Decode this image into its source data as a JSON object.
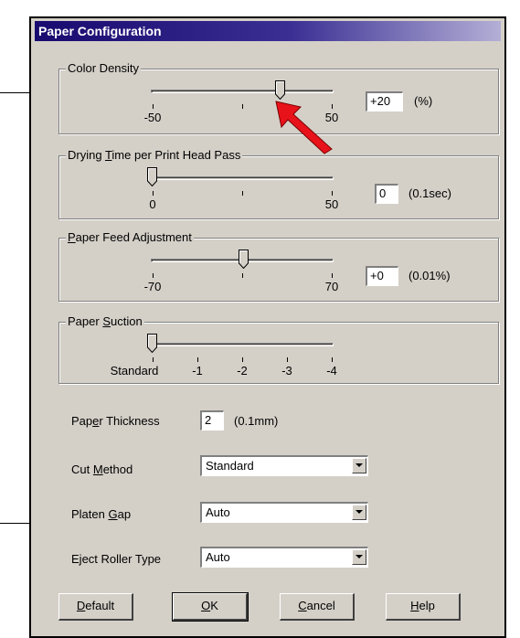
{
  "window": {
    "title": "Paper Configuration"
  },
  "color_density": {
    "label": "Color Density",
    "ticks": [
      "-50",
      "50"
    ],
    "value": "+20",
    "unit": "(%)",
    "min": -50,
    "max": 50,
    "current": 20
  },
  "drying_time": {
    "label_pre": "Drying ",
    "label_mn": "T",
    "label_post": "ime per Print Head Pass",
    "ticks": [
      "0",
      "50"
    ],
    "value": "0",
    "unit": "(0.1sec)",
    "min": 0,
    "max": 50,
    "current": 0
  },
  "paper_feed": {
    "label_mn": "P",
    "label_post": "aper Feed Adjustment",
    "ticks": [
      "-70",
      "70"
    ],
    "value": "+0",
    "unit": "(0.01%)",
    "min": -70,
    "max": 70,
    "current": 0
  },
  "paper_suction": {
    "label_pre": "Paper ",
    "label_mn": "S",
    "label_post": "uction",
    "ticks": [
      "Standard",
      "-1",
      "-2",
      "-3",
      "-4"
    ],
    "current": 0
  },
  "paper_thickness": {
    "label_pre": "Pap",
    "label_mn": "e",
    "label_post": "r Thickness",
    "value": "2",
    "unit": "(0.1mm)"
  },
  "cut_method": {
    "label_pre": "Cut ",
    "label_mn": "M",
    "label_post": "ethod",
    "value": "Standard"
  },
  "platen_gap": {
    "label_pre": "Platen ",
    "label_mn": "G",
    "label_post": "ap",
    "value": "Auto"
  },
  "eject_roller": {
    "label_pre": "E",
    "label_mn": "j",
    "label_post": "ect Roller Type",
    "value": "Auto"
  },
  "buttons": {
    "default": {
      "mn": "D",
      "rest": "efault"
    },
    "ok": {
      "mn": "O",
      "rest": "K"
    },
    "cancel": {
      "mn": "C",
      "rest": "ancel"
    },
    "help": {
      "mn": "H",
      "rest": "elp"
    }
  },
  "colors": {
    "dialog_face": "#d4d0c8",
    "title_start": "#180a6e",
    "title_end": "#b3afd6",
    "callout_arrow": "#e8121b"
  },
  "annotations": {
    "callout_arrow_icon": "red-arrow-icon"
  }
}
